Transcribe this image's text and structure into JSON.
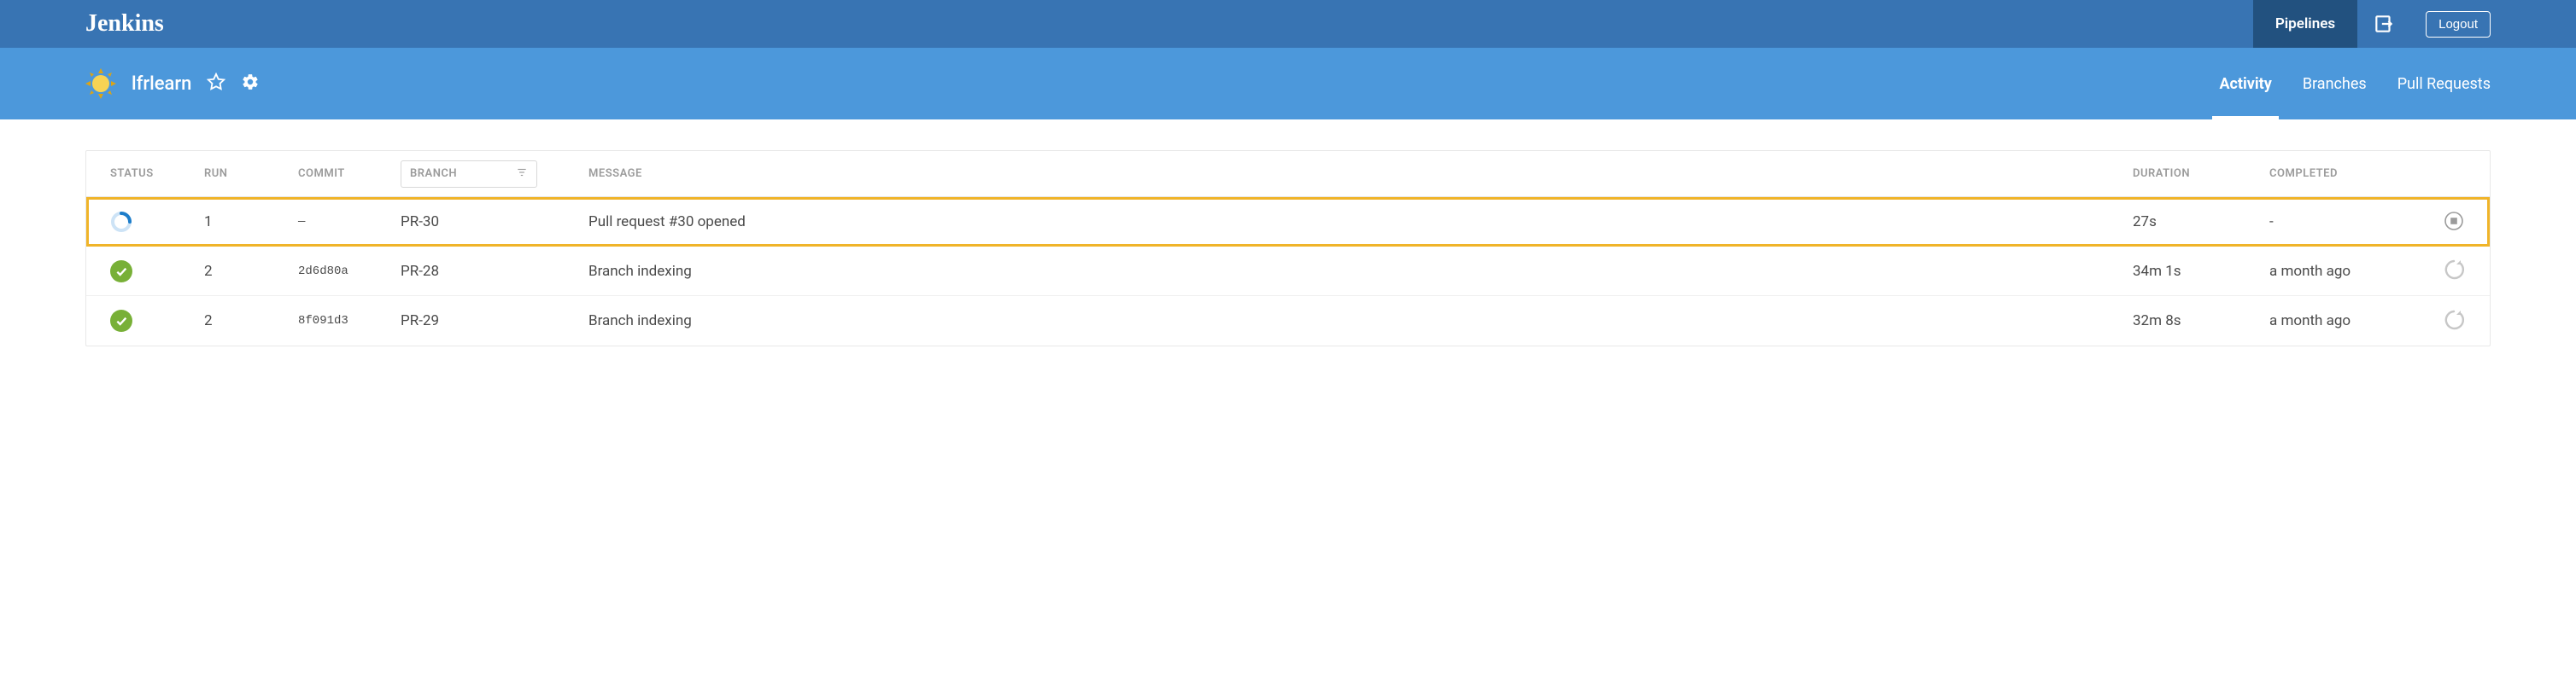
{
  "header": {
    "brand": "Jenkins",
    "nav": {
      "pipelines": "Pipelines"
    },
    "logout": "Logout"
  },
  "pipeline": {
    "name": "lfrlearn",
    "tabs": {
      "activity": "Activity",
      "branches": "Branches",
      "pull_requests": "Pull Requests"
    }
  },
  "table": {
    "headers": {
      "status": "Status",
      "run": "Run",
      "commit": "Commit",
      "branch": "Branch",
      "message": "Message",
      "duration": "Duration",
      "completed": "Completed"
    },
    "rows": [
      {
        "status": "running",
        "run": "1",
        "commit": "—",
        "branch": "PR-30",
        "message": "Pull request #30 opened",
        "duration": "27s",
        "completed": "-",
        "action": "stop",
        "highlighted": true
      },
      {
        "status": "success",
        "run": "2",
        "commit": "2d6d80a",
        "branch": "PR-28",
        "message": "Branch indexing",
        "duration": "34m 1s",
        "completed": "a month ago",
        "action": "rerun",
        "highlighted": false
      },
      {
        "status": "success",
        "run": "2",
        "commit": "8f091d3",
        "branch": "PR-29",
        "message": "Branch indexing",
        "duration": "32m 8s",
        "completed": "a month ago",
        "action": "rerun",
        "highlighted": false
      }
    ]
  }
}
